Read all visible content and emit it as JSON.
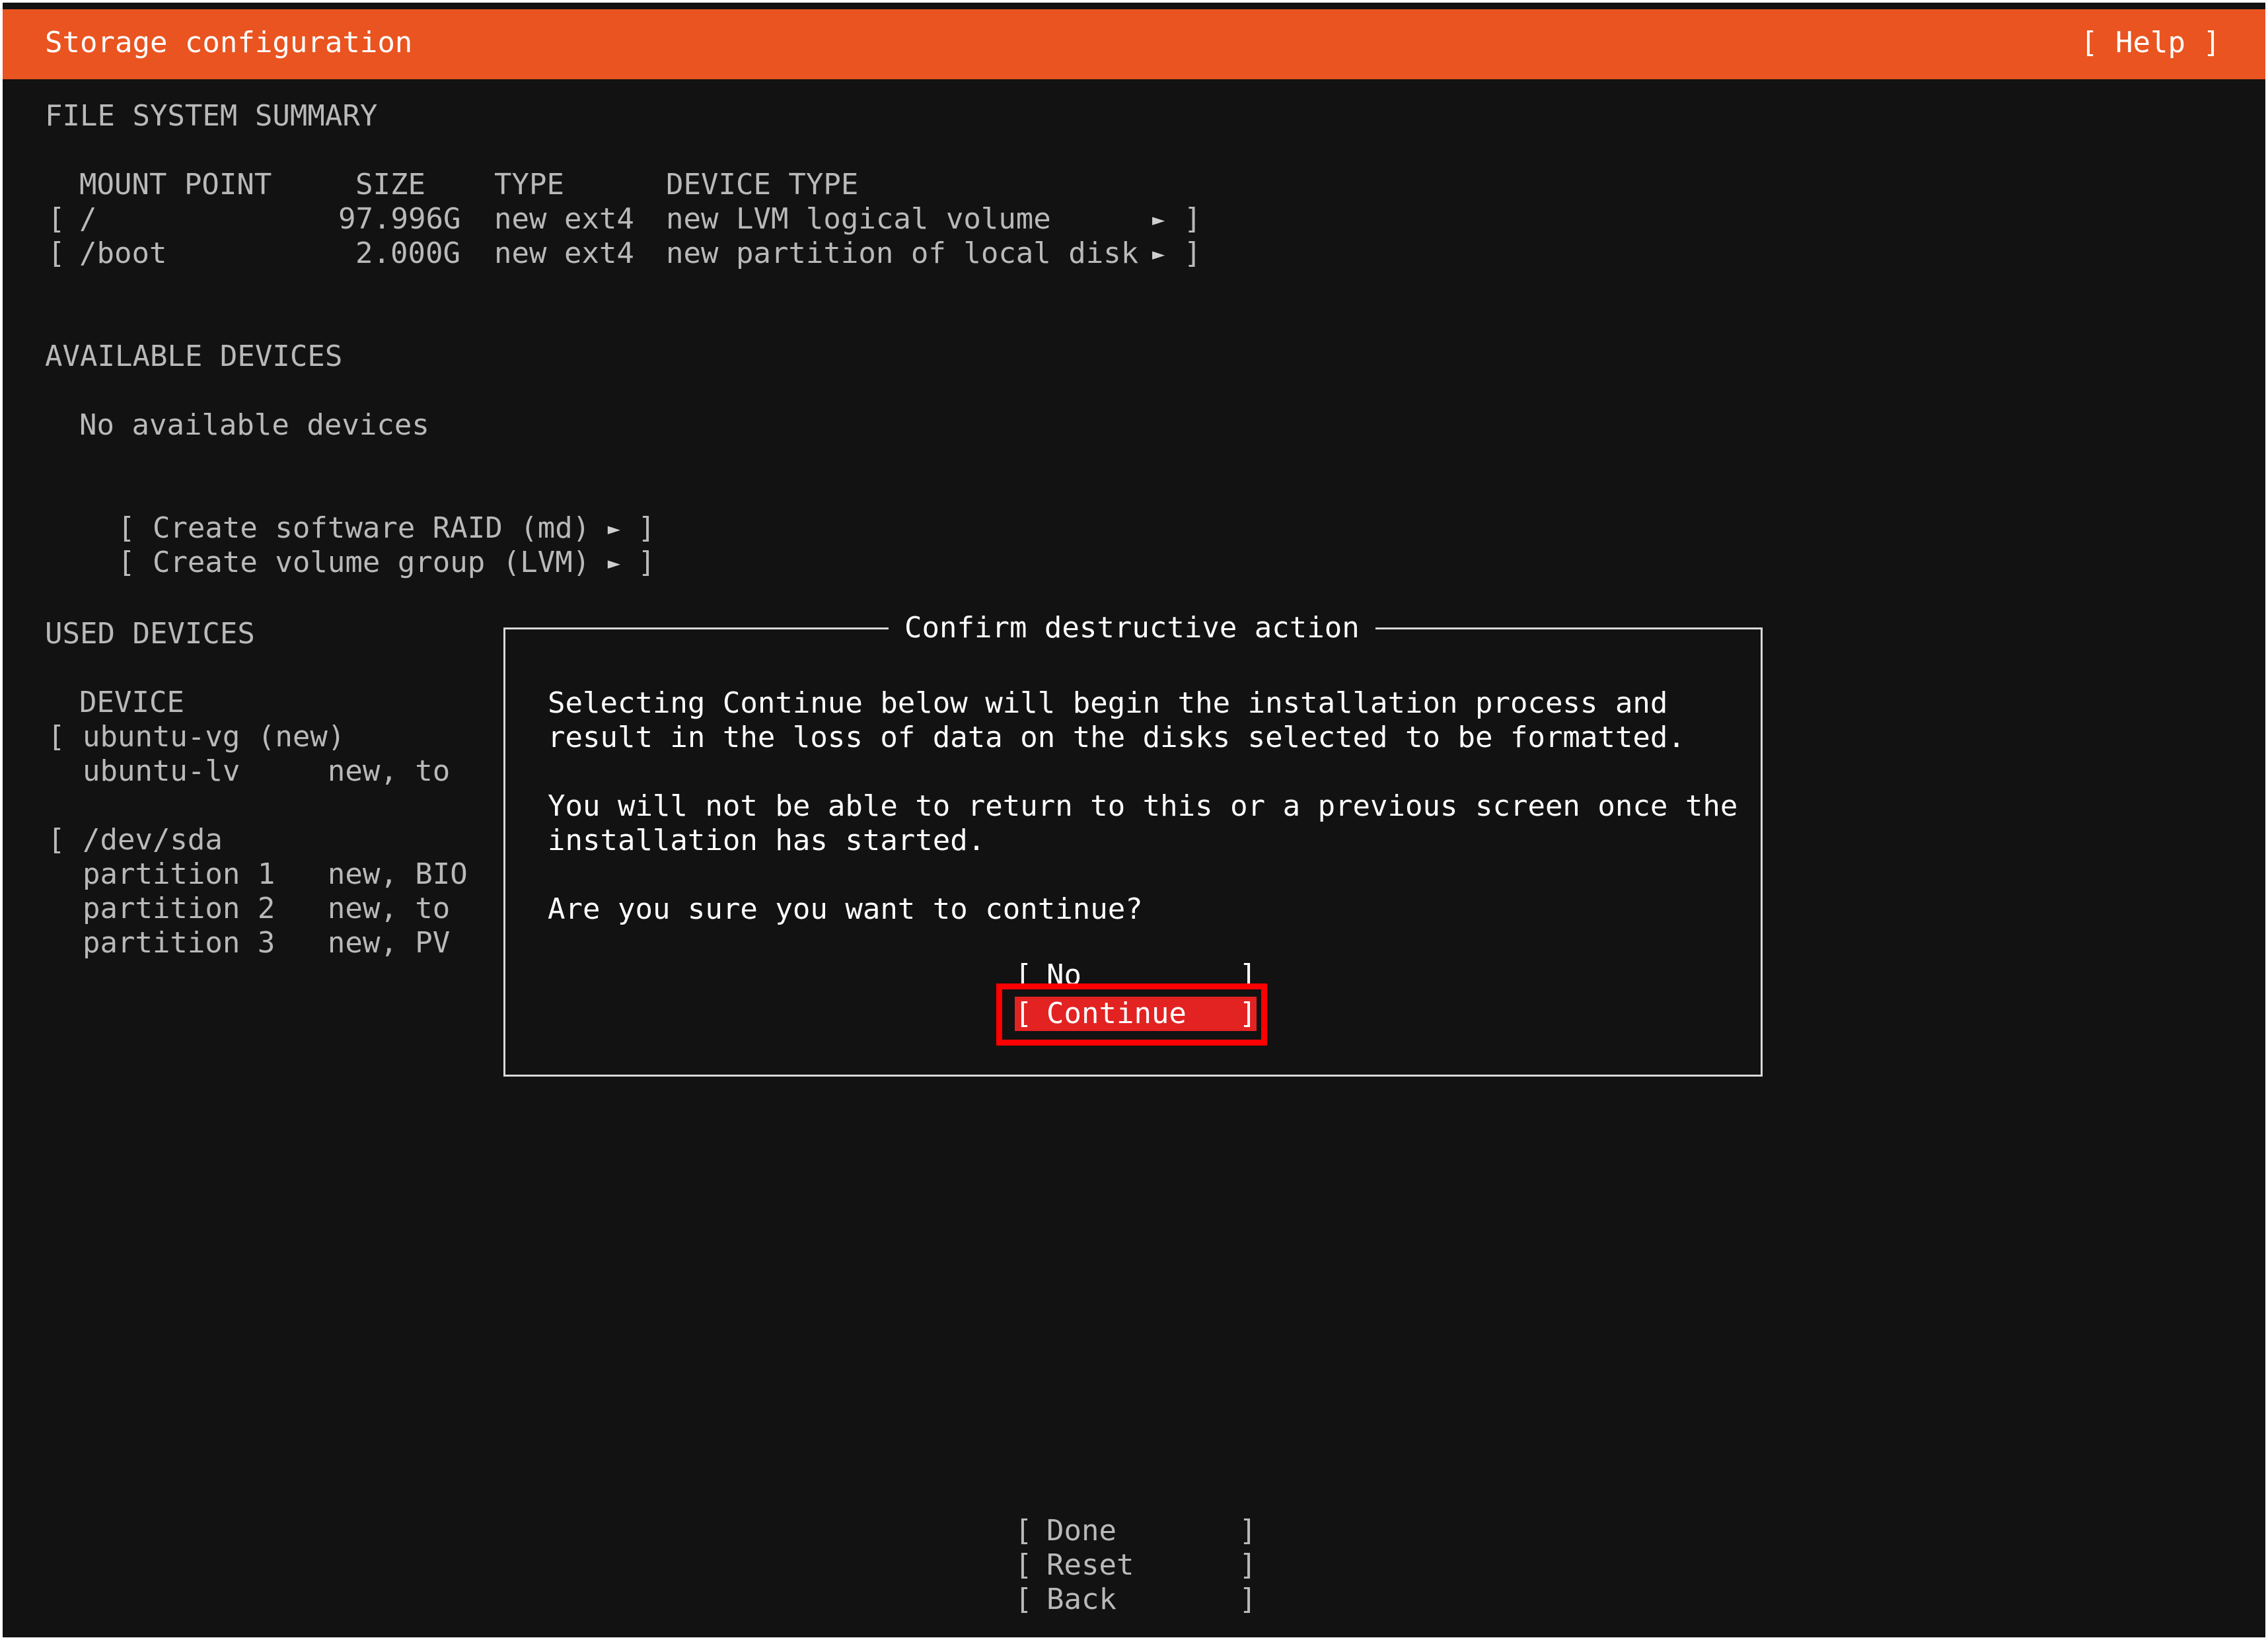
{
  "header": {
    "title": "Storage configuration",
    "help": "[ Help ]"
  },
  "fs_summary": {
    "heading": "FILE SYSTEM SUMMARY",
    "columns": {
      "mount_point": "MOUNT POINT",
      "size": "SIZE",
      "type": "TYPE",
      "device_type": "DEVICE TYPE"
    },
    "rows": [
      {
        "bracket": "[",
        "mount": "/",
        "size": "97.996G",
        "type": "new ext4",
        "device_type": "new LVM logical volume",
        "close": "]"
      },
      {
        "bracket": "[",
        "mount": "/boot",
        "size": "2.000G",
        "type": "new ext4",
        "device_type": "new partition of local disk",
        "close": "]"
      }
    ],
    "arrow_glyph": "►"
  },
  "available_devices": {
    "heading": "AVAILABLE DEVICES",
    "empty_message": "No available devices",
    "actions": [
      "[ Create software RAID (md) ",
      "[ Create volume group (LVM) "
    ],
    "action_close": " ]"
  },
  "used_devices": {
    "heading": "USED DEVICES",
    "device_header": "DEVICE",
    "lines": [
      "[ ubuntu-vg (new)",
      "  ubuntu-lv     new, to",
      "[ /dev/sda",
      "  partition 1   new, BIO",
      "  partition 2   new, to",
      "  partition 3   new, PV"
    ]
  },
  "dialog": {
    "title": "Confirm destructive action",
    "line1": "Selecting Continue below will begin the installation process and",
    "line2": "result in the loss of data on the disks selected to be formatted.",
    "line3": "You will not be able to return to this or a previous screen once the",
    "line4": "installation has started.",
    "question": "Are you sure you want to continue?",
    "no_label": "No",
    "continue_label": "Continue"
  },
  "footer": {
    "done": "Done",
    "reset": "Reset",
    "back": "Back"
  },
  "brackets": {
    "open": "[",
    "close": "]"
  },
  "colors": {
    "header_bg": "#e95420",
    "screen_bg": "#121212",
    "continue_bg": "#e32222",
    "highlight": "#ff0000"
  }
}
